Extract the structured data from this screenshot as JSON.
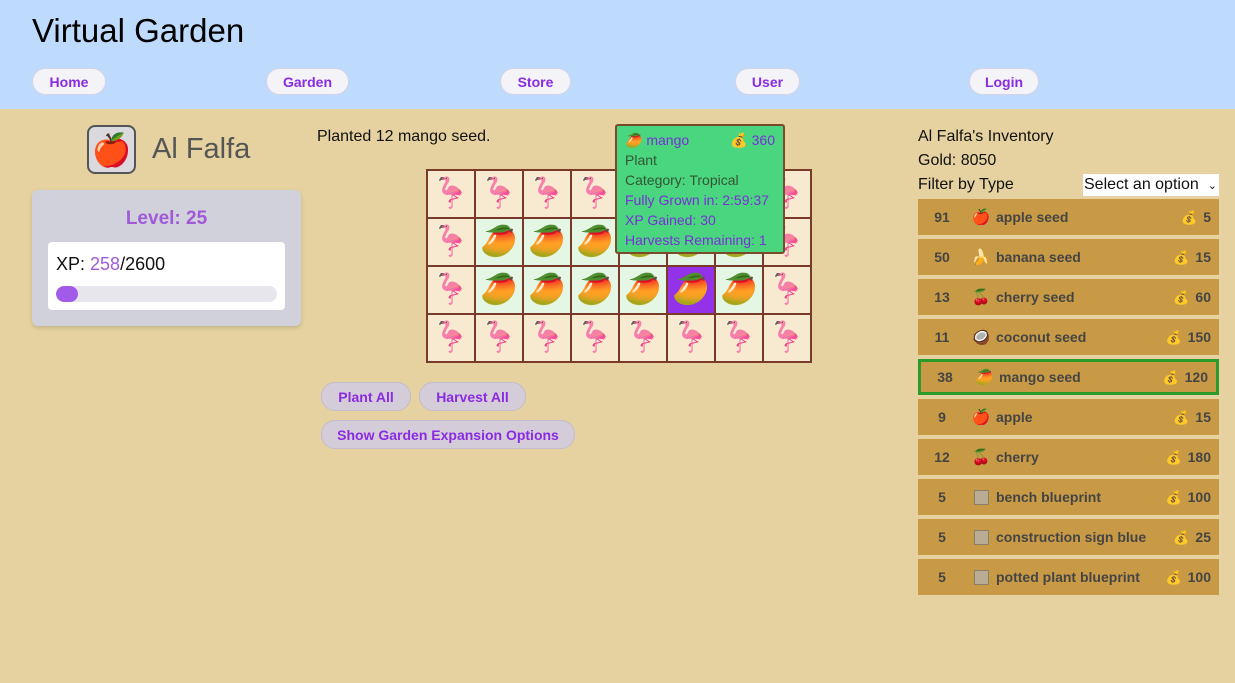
{
  "header": {
    "title": "Virtual Garden",
    "nav": [
      "Home",
      "Garden",
      "Store",
      "User",
      "Login"
    ]
  },
  "profile": {
    "avatar_icon": "🍎",
    "name": "Al Falfa",
    "level_label": "Level: 25",
    "xp_label": "XP: ",
    "xp_current": "258",
    "xp_total": "/2600",
    "xp_fraction": 0.0992
  },
  "garden": {
    "message": "Planted 12 mango seed.",
    "grid": [
      [
        "🦩",
        "🦩",
        "🦩",
        "🦩",
        "🦩",
        "🦩",
        "🦩",
        "🦩"
      ],
      [
        "🦩",
        "🥭",
        "🥭",
        "🥭",
        "🥭",
        "🥭",
        "🥭",
        "🦩"
      ],
      [
        "🦩",
        "🥭",
        "🥭",
        "🥭",
        "🥭",
        "🥭",
        "🥭",
        "🦩"
      ],
      [
        "🦩",
        "🦩",
        "🦩",
        "🦩",
        "🦩",
        "🦩",
        "🦩",
        "🦩"
      ]
    ],
    "selected_cell": [
      2,
      5
    ],
    "tooltip": {
      "icon": "🥭",
      "name": "mango",
      "coin_icon": "💰",
      "price": "360",
      "type": "Plant",
      "category": "Category: Tropical",
      "grown": "Fully Grown in: 2:59:37",
      "xp": "XP Gained: 30",
      "harvests": "Harvests Remaining: 1"
    },
    "buttons": {
      "plant_all": "Plant All",
      "harvest_all": "Harvest All",
      "expansion": "Show Garden Expansion Options"
    }
  },
  "inventory": {
    "title": "Al Falfa's Inventory",
    "gold": "Gold: 8050",
    "filter_label": "Filter by Type",
    "filter_value": "Select an option",
    "coin_icon": "💰",
    "items": [
      {
        "qty": "91",
        "icon": "🍎",
        "name": "apple seed",
        "price": "5"
      },
      {
        "qty": "50",
        "icon": "🍌",
        "name": "banana seed",
        "price": "15"
      },
      {
        "qty": "13",
        "icon": "🍒",
        "name": "cherry seed",
        "price": "60"
      },
      {
        "qty": "11",
        "icon": "🥥",
        "name": "coconut seed",
        "price": "150"
      },
      {
        "qty": "38",
        "icon": "🥭",
        "name": "mango seed",
        "price": "120",
        "selected": true
      },
      {
        "qty": "9",
        "icon": "🍎",
        "name": "apple",
        "price": "15"
      },
      {
        "qty": "12",
        "icon": "🍒",
        "name": "cherry",
        "price": "180"
      },
      {
        "qty": "5",
        "icon": "blueprint-icon",
        "name": "bench blueprint",
        "price": "100"
      },
      {
        "qty": "5",
        "icon": "blueprint-icon",
        "name": "construction sign blueprint",
        "price": "25"
      },
      {
        "qty": "5",
        "icon": "blueprint-icon",
        "name": "potted plant blueprint",
        "price": "100"
      }
    ]
  }
}
